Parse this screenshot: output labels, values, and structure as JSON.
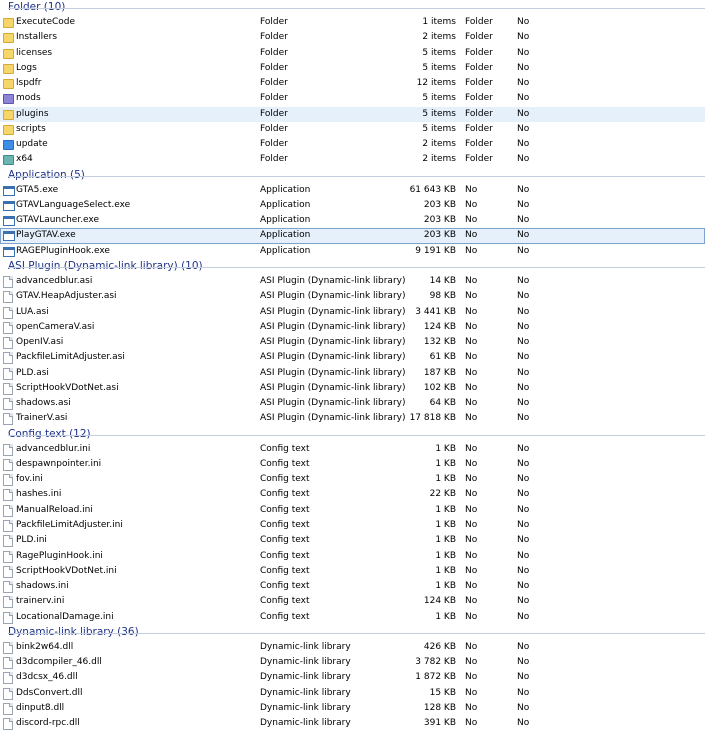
{
  "groups": [
    {
      "title": "Folder (10)",
      "rows": [
        {
          "name": "ExecuteCode",
          "type": "Folder",
          "size": "1 items",
          "col4": "Folder",
          "col5": "No",
          "icon": "folder-icon"
        },
        {
          "name": "Installers",
          "type": "Folder",
          "size": "2 items",
          "col4": "Folder",
          "col5": "No",
          "icon": "folder-icon"
        },
        {
          "name": "licenses",
          "type": "Folder",
          "size": "5 items",
          "col4": "Folder",
          "col5": "No",
          "icon": "folder-icon"
        },
        {
          "name": "Logs",
          "type": "Folder",
          "size": "5 items",
          "col4": "Folder",
          "col5": "No",
          "icon": "folder-icon"
        },
        {
          "name": "lspdfr",
          "type": "Folder",
          "size": "12 items",
          "col4": "Folder",
          "col5": "No",
          "icon": "folder-icon"
        },
        {
          "name": "mods",
          "type": "Folder",
          "size": "5 items",
          "col4": "Folder",
          "col5": "No",
          "icon": "folder-purple-icon"
        },
        {
          "name": "plugins",
          "type": "Folder",
          "size": "5 items",
          "col4": "Folder",
          "col5": "No",
          "icon": "folder-icon",
          "selected": "hover"
        },
        {
          "name": "scripts",
          "type": "Folder",
          "size": "5 items",
          "col4": "Folder",
          "col5": "No",
          "icon": "folder-icon"
        },
        {
          "name": "update",
          "type": "Folder",
          "size": "2 items",
          "col4": "Folder",
          "col5": "No",
          "icon": "folder-blue-icon"
        },
        {
          "name": "x64",
          "type": "Folder",
          "size": "2 items",
          "col4": "Folder",
          "col5": "No",
          "icon": "folder-teal-icon"
        }
      ]
    },
    {
      "title": "Application (5)",
      "rows": [
        {
          "name": "GTA5.exe",
          "type": "Application",
          "size": "61 643 KB",
          "col4": "No",
          "col5": "No",
          "icon": "exe-icon"
        },
        {
          "name": "GTAVLanguageSelect.exe",
          "type": "Application",
          "size": "203 KB",
          "col4": "No",
          "col5": "No",
          "icon": "exe-icon"
        },
        {
          "name": "GTAVLauncher.exe",
          "type": "Application",
          "size": "203 KB",
          "col4": "No",
          "col5": "No",
          "icon": "exe-icon"
        },
        {
          "name": "PlayGTAV.exe",
          "type": "Application",
          "size": "203 KB",
          "col4": "No",
          "col5": "No",
          "icon": "exe-icon",
          "selected": "focus"
        },
        {
          "name": "RAGEPluginHook.exe",
          "type": "Application",
          "size": "9 191 KB",
          "col4": "No",
          "col5": "No",
          "icon": "exe-icon"
        }
      ]
    },
    {
      "title": "ASI Plugin (Dynamic-link library) (10)",
      "rows": [
        {
          "name": "advancedblur.asi",
          "type": "ASI Plugin (Dynamic-link library)",
          "size": "14 KB",
          "col4": "No",
          "col5": "No",
          "icon": "file-icon"
        },
        {
          "name": "GTAV.HeapAdjuster.asi",
          "type": "ASI Plugin (Dynamic-link library)",
          "size": "98 KB",
          "col4": "No",
          "col5": "No",
          "icon": "file-icon"
        },
        {
          "name": "LUA.asi",
          "type": "ASI Plugin (Dynamic-link library)",
          "size": "3 441 KB",
          "col4": "No",
          "col5": "No",
          "icon": "file-icon"
        },
        {
          "name": "openCameraV.asi",
          "type": "ASI Plugin (Dynamic-link library)",
          "size": "124 KB",
          "col4": "No",
          "col5": "No",
          "icon": "file-icon"
        },
        {
          "name": "OpenIV.asi",
          "type": "ASI Plugin (Dynamic-link library)",
          "size": "132 KB",
          "col4": "No",
          "col5": "No",
          "icon": "file-icon"
        },
        {
          "name": "PackfileLimitAdjuster.asi",
          "type": "ASI Plugin (Dynamic-link library)",
          "size": "61 KB",
          "col4": "No",
          "col5": "No",
          "icon": "file-icon"
        },
        {
          "name": "PLD.asi",
          "type": "ASI Plugin (Dynamic-link library)",
          "size": "187 KB",
          "col4": "No",
          "col5": "No",
          "icon": "file-icon"
        },
        {
          "name": "ScriptHookVDotNet.asi",
          "type": "ASI Plugin (Dynamic-link library)",
          "size": "102 KB",
          "col4": "No",
          "col5": "No",
          "icon": "file-icon"
        },
        {
          "name": "shadows.asi",
          "type": "ASI Plugin (Dynamic-link library)",
          "size": "64 KB",
          "col4": "No",
          "col5": "No",
          "icon": "file-icon"
        },
        {
          "name": "TrainerV.asi",
          "type": "ASI Plugin (Dynamic-link library)",
          "size": "17 818 KB",
          "col4": "No",
          "col5": "No",
          "icon": "file-icon"
        }
      ]
    },
    {
      "title": "Config text (12)",
      "rows": [
        {
          "name": "advancedblur.ini",
          "type": "Config text",
          "size": "1 KB",
          "col4": "No",
          "col5": "No",
          "icon": "file-icon"
        },
        {
          "name": "despawnpointer.ini",
          "type": "Config text",
          "size": "1 KB",
          "col4": "No",
          "col5": "No",
          "icon": "file-icon"
        },
        {
          "name": "fov.ini",
          "type": "Config text",
          "size": "1 KB",
          "col4": "No",
          "col5": "No",
          "icon": "file-icon"
        },
        {
          "name": "hashes.ini",
          "type": "Config text",
          "size": "22 KB",
          "col4": "No",
          "col5": "No",
          "icon": "file-icon"
        },
        {
          "name": "ManualReload.ini",
          "type": "Config text",
          "size": "1 KB",
          "col4": "No",
          "col5": "No",
          "icon": "file-icon"
        },
        {
          "name": "PackfileLimitAdjuster.ini",
          "type": "Config text",
          "size": "1 KB",
          "col4": "No",
          "col5": "No",
          "icon": "file-icon"
        },
        {
          "name": "PLD.ini",
          "type": "Config text",
          "size": "1 KB",
          "col4": "No",
          "col5": "No",
          "icon": "file-icon"
        },
        {
          "name": "RagePluginHook.ini",
          "type": "Config text",
          "size": "1 KB",
          "col4": "No",
          "col5": "No",
          "icon": "file-icon"
        },
        {
          "name": "ScriptHookVDotNet.ini",
          "type": "Config text",
          "size": "1 KB",
          "col4": "No",
          "col5": "No",
          "icon": "file-icon"
        },
        {
          "name": "shadows.ini",
          "type": "Config text",
          "size": "1 KB",
          "col4": "No",
          "col5": "No",
          "icon": "file-icon"
        },
        {
          "name": "trainerv.ini",
          "type": "Config text",
          "size": "124 KB",
          "col4": "No",
          "col5": "No",
          "icon": "file-icon"
        },
        {
          "name": "LocationalDamage.ini",
          "type": "Config text",
          "size": "1 KB",
          "col4": "No",
          "col5": "No",
          "icon": "file-icon"
        }
      ]
    },
    {
      "title": "Dynamic-link library (36)",
      "rows": [
        {
          "name": "bink2w64.dll",
          "type": "Dynamic-link library",
          "size": "426 KB",
          "col4": "No",
          "col5": "No",
          "icon": "file-icon"
        },
        {
          "name": "d3dcompiler_46.dll",
          "type": "Dynamic-link library",
          "size": "3 782 KB",
          "col4": "No",
          "col5": "No",
          "icon": "file-icon"
        },
        {
          "name": "d3dcsx_46.dll",
          "type": "Dynamic-link library",
          "size": "1 872 KB",
          "col4": "No",
          "col5": "No",
          "icon": "file-icon"
        },
        {
          "name": "DdsConvert.dll",
          "type": "Dynamic-link library",
          "size": "15 KB",
          "col4": "No",
          "col5": "No",
          "icon": "file-icon"
        },
        {
          "name": "dinput8.dll",
          "type": "Dynamic-link library",
          "size": "128 KB",
          "col4": "No",
          "col5": "No",
          "icon": "file-icon"
        },
        {
          "name": "discord-rpc.dll",
          "type": "Dynamic-link library",
          "size": "391 KB",
          "col4": "No",
          "col5": "No",
          "icon": "file-icon"
        }
      ]
    }
  ]
}
